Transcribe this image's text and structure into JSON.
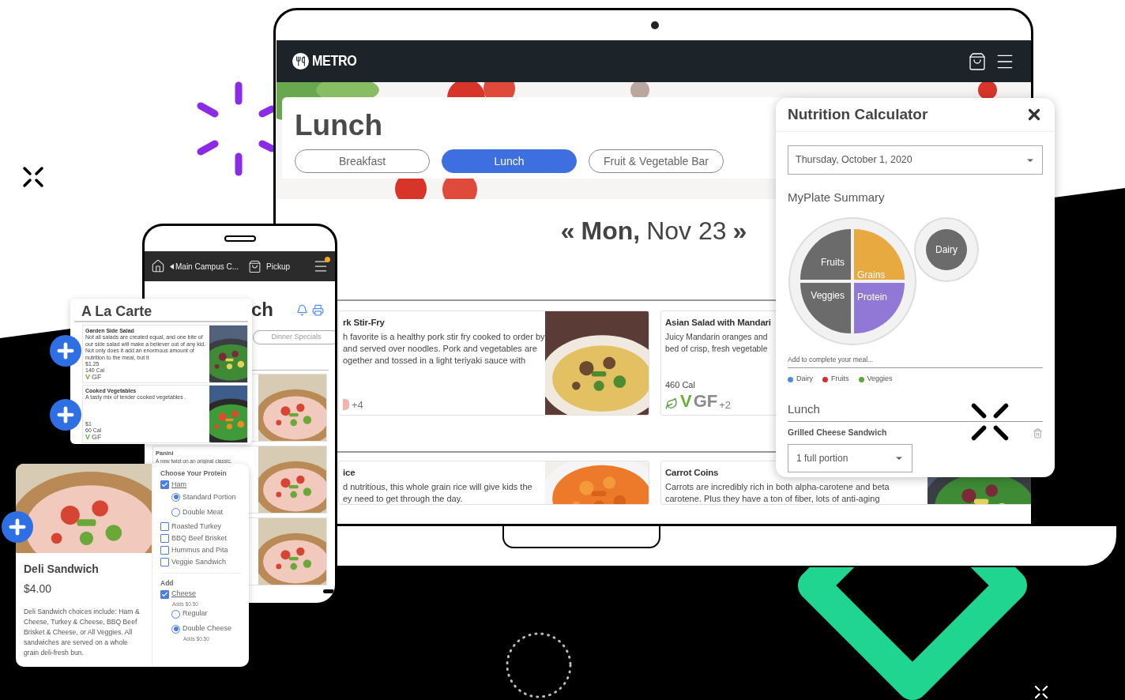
{
  "laptop": {
    "brand": "METRO",
    "page_title": "Lunch",
    "tabs": [
      {
        "label": "Breakfast",
        "selected": false
      },
      {
        "label": "Lunch",
        "selected": true
      },
      {
        "label": "Fruit & Vegetable Bar",
        "selected": false
      }
    ],
    "date_nav": {
      "prev": "«",
      "day": "Mon,",
      "date": "Nov 23",
      "next": "»"
    },
    "menu_items": [
      {
        "name": "rk Stir-Fry",
        "description": [
          "h favorite is a healthy pork stir fry cooked to order by",
          "and served over noodles. Pork and vegetables are",
          "ogether and tossed in a light teriyaki sauce with"
        ],
        "more_tags": "+4",
        "photo": {
          "kind": "picture"
        }
      },
      {
        "name": "Asian Salad with Mandari",
        "description": [
          "Juicy Mandarin oranges and",
          "bed of crisp, fresh vegetable"
        ],
        "calories": "460 Cal",
        "tags": [
          "V",
          "GF"
        ],
        "more_tags": "+2"
      },
      {
        "name": "ice",
        "description": [
          "d nutritious, this whole grain rice will give kids the",
          "ey need to get through the day."
        ],
        "photo": {
          "kind": "picture"
        }
      },
      {
        "name": "Carrot Coins",
        "description": [
          "Carrots are incredibly rich in both alpha-carotene and beta",
          "carotene. Plus they have a ton of fiber, lots of anti-aging"
        ],
        "photo": {
          "kind": "picture"
        }
      }
    ]
  },
  "nutrition": {
    "title": "Nutrition Calculator",
    "date": "Thursday, October 1, 2020",
    "summary_title": "MyPlate Summary",
    "plate": [
      {
        "label": "Fruits",
        "color": "#6b6b6b"
      },
      {
        "label": "Grains",
        "color": "#e8a941"
      },
      {
        "label": "Veggies",
        "color": "#6b6b6b"
      },
      {
        "label": "Protein",
        "color": "#9178d6"
      }
    ],
    "dairy": {
      "label": "Dairy",
      "color": "#6b6b6b"
    },
    "hint": "Add to complete your meal...",
    "legend": [
      {
        "label": "Dairy",
        "color": "#4a8fdd"
      },
      {
        "label": "Fruits",
        "color": "#d0302c"
      },
      {
        "label": "Veggies",
        "color": "#59a838"
      }
    ],
    "meal": "Lunch",
    "meal_item": "Grilled Cheese Sandwich",
    "portion": "1 full portion"
  },
  "phone": {
    "location": "Main Campus C...",
    "mode": "Pickup",
    "menu_notification": true,
    "title": "ch",
    "tab": "Dinner Specials",
    "item_name": "Panini",
    "item_description": "A new twist on an original classic."
  },
  "a_la_carte": {
    "title": "A La Carte",
    "items": [
      {
        "name": "Garden Side Salad",
        "description": "Not all salads are created equal, and one bite of our side salad will make a believer out of any kid. Not only does it add an enormous amount of nutrition to the meal, but it",
        "price": "$1.25",
        "calories": "140 Cal",
        "tags": [
          "V",
          "GF"
        ]
      },
      {
        "name": "Cooked Vegetables",
        "description": "A tasty mix of tender cooked vegetables .",
        "price": "$1",
        "calories": "60 Cal",
        "tags": [
          "V",
          "GF"
        ]
      }
    ]
  },
  "deli": {
    "name": "Deli Sandwich",
    "price": "$4.00",
    "description": "Deli Sandwich choices include: Ham & Cheese, Turkey & Cheese, BBQ Beef Brisket & Cheese, or All Veggies. All sandwiches are served on a whole grain deli-fresh bun.",
    "groups": [
      {
        "title": "Choose Your Protein",
        "choices": [
          {
            "kind": "checkbox",
            "label": "Ham",
            "checked": true,
            "children": [
              {
                "kind": "radio",
                "label": "Standard Portion",
                "selected": true
              },
              {
                "kind": "radio",
                "label": "Double Meat",
                "selected": false
              }
            ]
          },
          {
            "kind": "checkbox",
            "label": "Roasted Turkey",
            "checked": false
          },
          {
            "kind": "checkbox",
            "label": "BBQ Beef Brisket",
            "checked": false
          },
          {
            "kind": "checkbox",
            "label": "Hummus and Pita",
            "checked": false
          },
          {
            "kind": "checkbox",
            "label": "Veggie Sandwich",
            "checked": false
          }
        ]
      },
      {
        "title": "Add",
        "choices": [
          {
            "kind": "checkbox",
            "label": "Cheese",
            "checked": true,
            "note": "Adds $0.50",
            "children": [
              {
                "kind": "radio",
                "label": "Regular",
                "selected": false
              },
              {
                "kind": "radio",
                "label": "Double Cheese",
                "selected": true,
                "note": "Adds $0.50"
              }
            ]
          }
        ]
      }
    ]
  }
}
